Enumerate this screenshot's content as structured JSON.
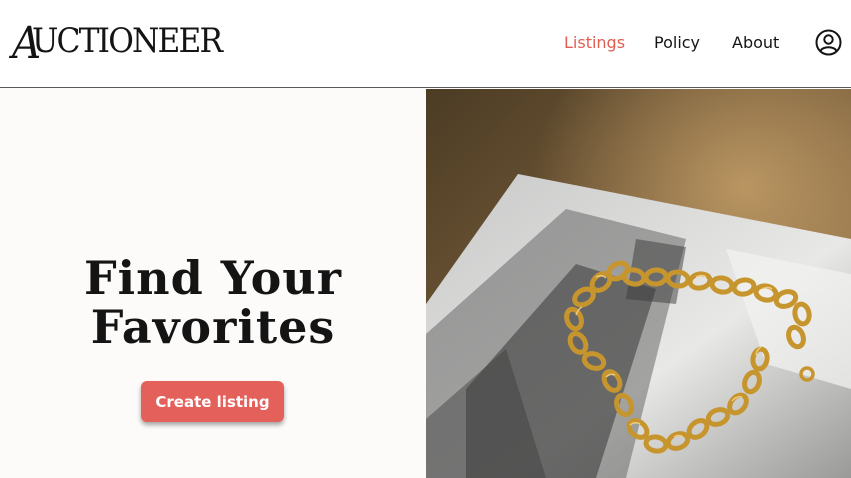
{
  "brand": {
    "logo_text": "AUCTIONEER"
  },
  "nav": {
    "items": [
      {
        "label": "Listings",
        "active": true
      },
      {
        "label": "Policy",
        "active": false
      },
      {
        "label": "About",
        "active": false
      }
    ],
    "account_icon": "user-circle-icon"
  },
  "hero": {
    "title_line1": "Find Your",
    "title_line2": "Favorites",
    "cta_label": "Create listing",
    "image_subject": "gold chain bracelet on magazine page"
  },
  "colors": {
    "accent": "#e4605a",
    "active_nav": "#e05d52",
    "text": "#141414",
    "background": "#fcfbf9"
  }
}
